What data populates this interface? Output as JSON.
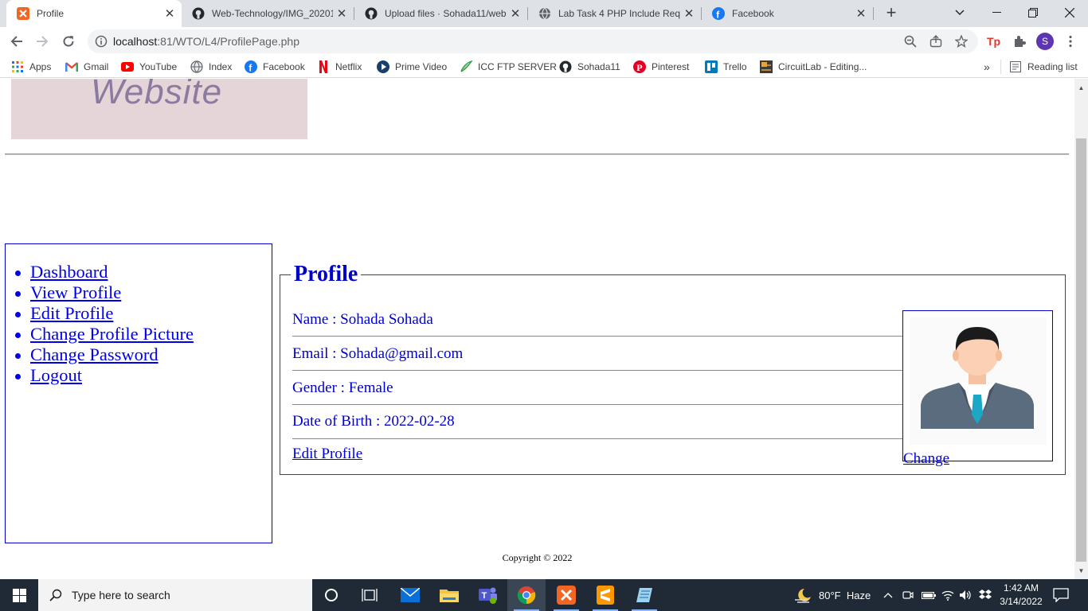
{
  "browser": {
    "tabs": [
      {
        "title": "Profile",
        "icon": "xampp-icon",
        "active": true
      },
      {
        "title": "Web-Technology/IMG_20201",
        "icon": "github-icon"
      },
      {
        "title": "Upload files · Sohada11/web",
        "icon": "github-icon"
      },
      {
        "title": "Lab Task 4 PHP Include Requ",
        "icon": "globe-icon"
      },
      {
        "title": "Facebook",
        "icon": "facebook-icon"
      }
    ],
    "url_host": "localhost",
    "url_rest": ":81/WTO/L4/ProfilePage.php",
    "profile_initial": "S",
    "bookmarks": [
      {
        "label": "Apps",
        "icon": "apps-grid-icon"
      },
      {
        "label": "Gmail",
        "icon": "gmail-icon"
      },
      {
        "label": "YouTube",
        "icon": "youtube-icon"
      },
      {
        "label": "Index",
        "icon": "globe-icon"
      },
      {
        "label": "Facebook",
        "icon": "facebook-icon"
      },
      {
        "label": "Netflix",
        "icon": "netflix-icon"
      },
      {
        "label": "Prime Video",
        "icon": "prime-video-icon"
      },
      {
        "label": "ICC FTP SERVER",
        "icon": "feather-icon"
      },
      {
        "label": "Sohada11",
        "icon": "github-icon"
      },
      {
        "label": "Pinterest",
        "icon": "pinterest-icon"
      },
      {
        "label": "Trello",
        "icon": "trello-icon"
      },
      {
        "label": "CircuitLab - Editing...",
        "icon": "circuitlab-icon"
      }
    ],
    "overflow": "»",
    "reading_list": "Reading list"
  },
  "page": {
    "banner_text": "Website",
    "nav": [
      "Dashboard",
      "View Profile",
      "Edit Profile",
      "Change Profile Picture",
      "Change Password",
      "Logout"
    ],
    "profile": {
      "legend": "Profile",
      "name": "Name : Sohada Sohada",
      "email": "Email : Sohada@gmail.com",
      "gender": "Gender : Female",
      "dob": "Date of Birth : 2022-02-28",
      "edit_link": "Edit Profile",
      "change_link": "Change"
    },
    "copyright": "Copyright © 2022"
  },
  "taskbar": {
    "search_placeholder": "Type here to search",
    "weather": "80°F  Haze",
    "time": "1:42 AM",
    "date": "3/14/2022"
  },
  "colors": {
    "link": "#0000ee",
    "text_blue": "#0000cc",
    "taskbar": "#1f2a36",
    "chrome_tabstrip": "#dee1e6"
  }
}
